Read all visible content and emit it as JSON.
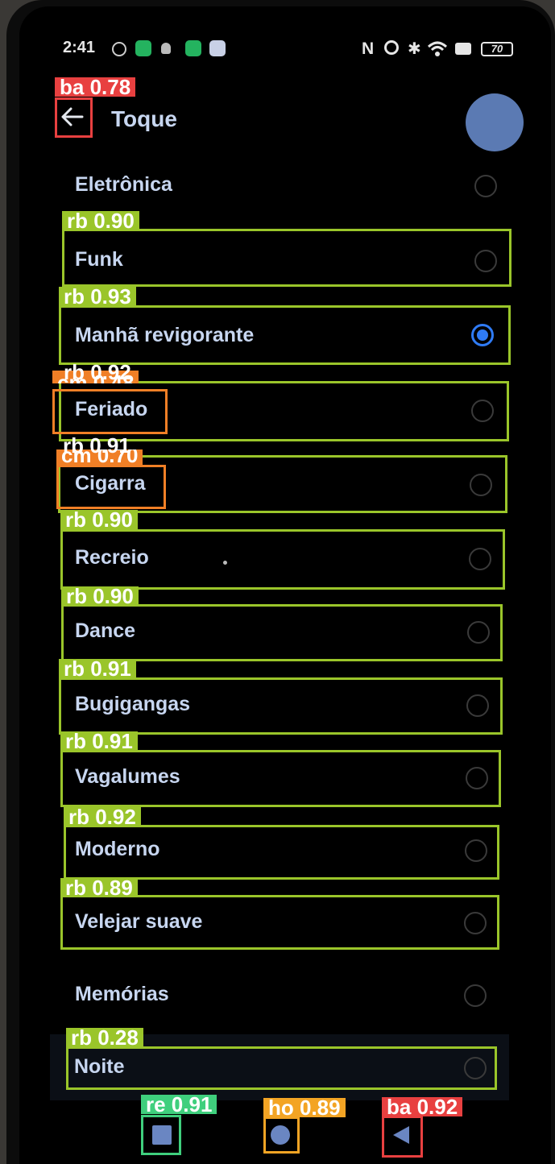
{
  "status_bar": {
    "time": "2:41",
    "battery": "70"
  },
  "header": {
    "title": "Toque"
  },
  "ringtones": [
    {
      "label": "Eletrônica",
      "selected": false
    },
    {
      "label": "Funk",
      "selected": false
    },
    {
      "label": "Manhã revigorante",
      "selected": true
    },
    {
      "label": "Feriado",
      "selected": false
    },
    {
      "label": "Cigarra",
      "selected": false
    },
    {
      "label": "Recreio",
      "selected": false
    },
    {
      "label": "Dance",
      "selected": false
    },
    {
      "label": "Bugigangas",
      "selected": false
    },
    {
      "label": "Vagalumes",
      "selected": false
    },
    {
      "label": "Moderno",
      "selected": false
    },
    {
      "label": "Velejar suave",
      "selected": false
    },
    {
      "label": "Memórias",
      "selected": false
    },
    {
      "label": "Noite",
      "selected": false
    }
  ],
  "detections": {
    "back": "ba 0.78",
    "funk": "rb 0.90",
    "manha": "rb 0.93",
    "feriado": "rb 0.92",
    "feriado_cm": "cm 0.48",
    "cigarra": "rb 0.91",
    "cigarra_cm": "cm 0.70",
    "recreio": "rb 0.90",
    "dance": "rb 0.90",
    "bugigangas": "rb 0.91",
    "vagalumes": "rb 0.91",
    "moderno": "rb 0.92",
    "velejar": "rb 0.89",
    "noite": "rb 0.28",
    "recents": "re 0.91",
    "home": "ho 0.89",
    "nav_back": "ba 0.92"
  },
  "colors": {
    "accent": "#2f7bf5",
    "rb_box": "#9ac52a",
    "ba_box": "#e84040",
    "cm_box": "#f07f26",
    "re_box": "#3fcf7d",
    "ho_box": "#f3a424"
  }
}
